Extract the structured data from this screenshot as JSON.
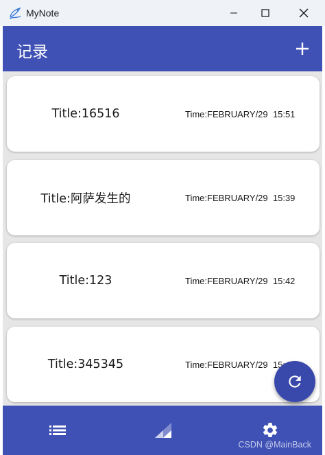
{
  "window": {
    "title": "MyNote"
  },
  "appbar": {
    "title": "记录",
    "add_icon": "plus-icon"
  },
  "notes": [
    {
      "title": "Title:16516",
      "time": "Time:FEBRUARY/29  15:51"
    },
    {
      "title": "Title:阿萨发生的",
      "time": "Time:FEBRUARY/29  15:39"
    },
    {
      "title": "Title:123",
      "time": "Time:FEBRUARY/29  15:42"
    },
    {
      "title": "Title:345345",
      "time": "Time:FEBRUARY/29  15:4"
    }
  ],
  "fab": {
    "icon": "refresh-icon"
  },
  "bottom_nav": [
    {
      "icon": "list-icon"
    },
    {
      "icon": "signal-icon"
    },
    {
      "icon": "gear-icon"
    }
  ],
  "watermark": "CSDN @MainBack",
  "colors": {
    "primary": "#3f51b5",
    "fab": "#3949ab",
    "titlebar": "#eff3f8",
    "background": "#e6e6e6"
  }
}
